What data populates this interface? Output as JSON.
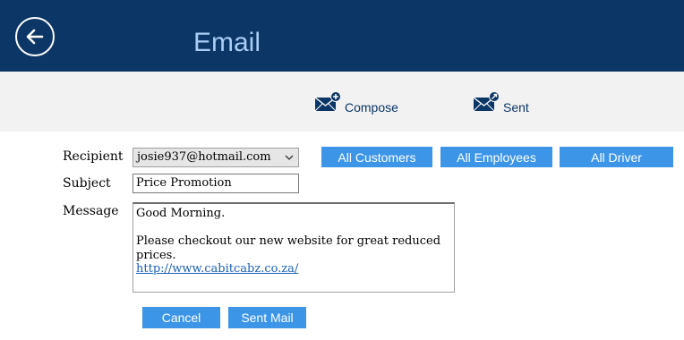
{
  "header": {
    "title": "Email",
    "background": "#0c3665",
    "title_color": "#a9cdf5",
    "back_icon": "arrow-left-icon"
  },
  "toolbar": {
    "compose_label": "Compose",
    "compose_icon": "envelope-plus-icon",
    "sent_label": "Sent",
    "sent_icon": "envelope-sent-icon"
  },
  "form": {
    "recipient_label": "Recipient",
    "recipient_value": "josie937@hotmail.com",
    "subject_label": "Subject",
    "subject_value": "Price Promotion",
    "message_label": "Message",
    "message_lines": [
      "Good Morning.",
      "",
      "Please checkout our new website for great reduced",
      "prices."
    ],
    "message_link": "http://www.cabitcabz.co.za/"
  },
  "groups": {
    "all_customers": "All Customers",
    "all_employees": "All Employees",
    "all_driver": "All Driver"
  },
  "actions": {
    "cancel": "Cancel",
    "send": "Sent Mail"
  },
  "colors": {
    "button": "#3d95e8",
    "toolbar_bg": "#f2f2f2"
  }
}
